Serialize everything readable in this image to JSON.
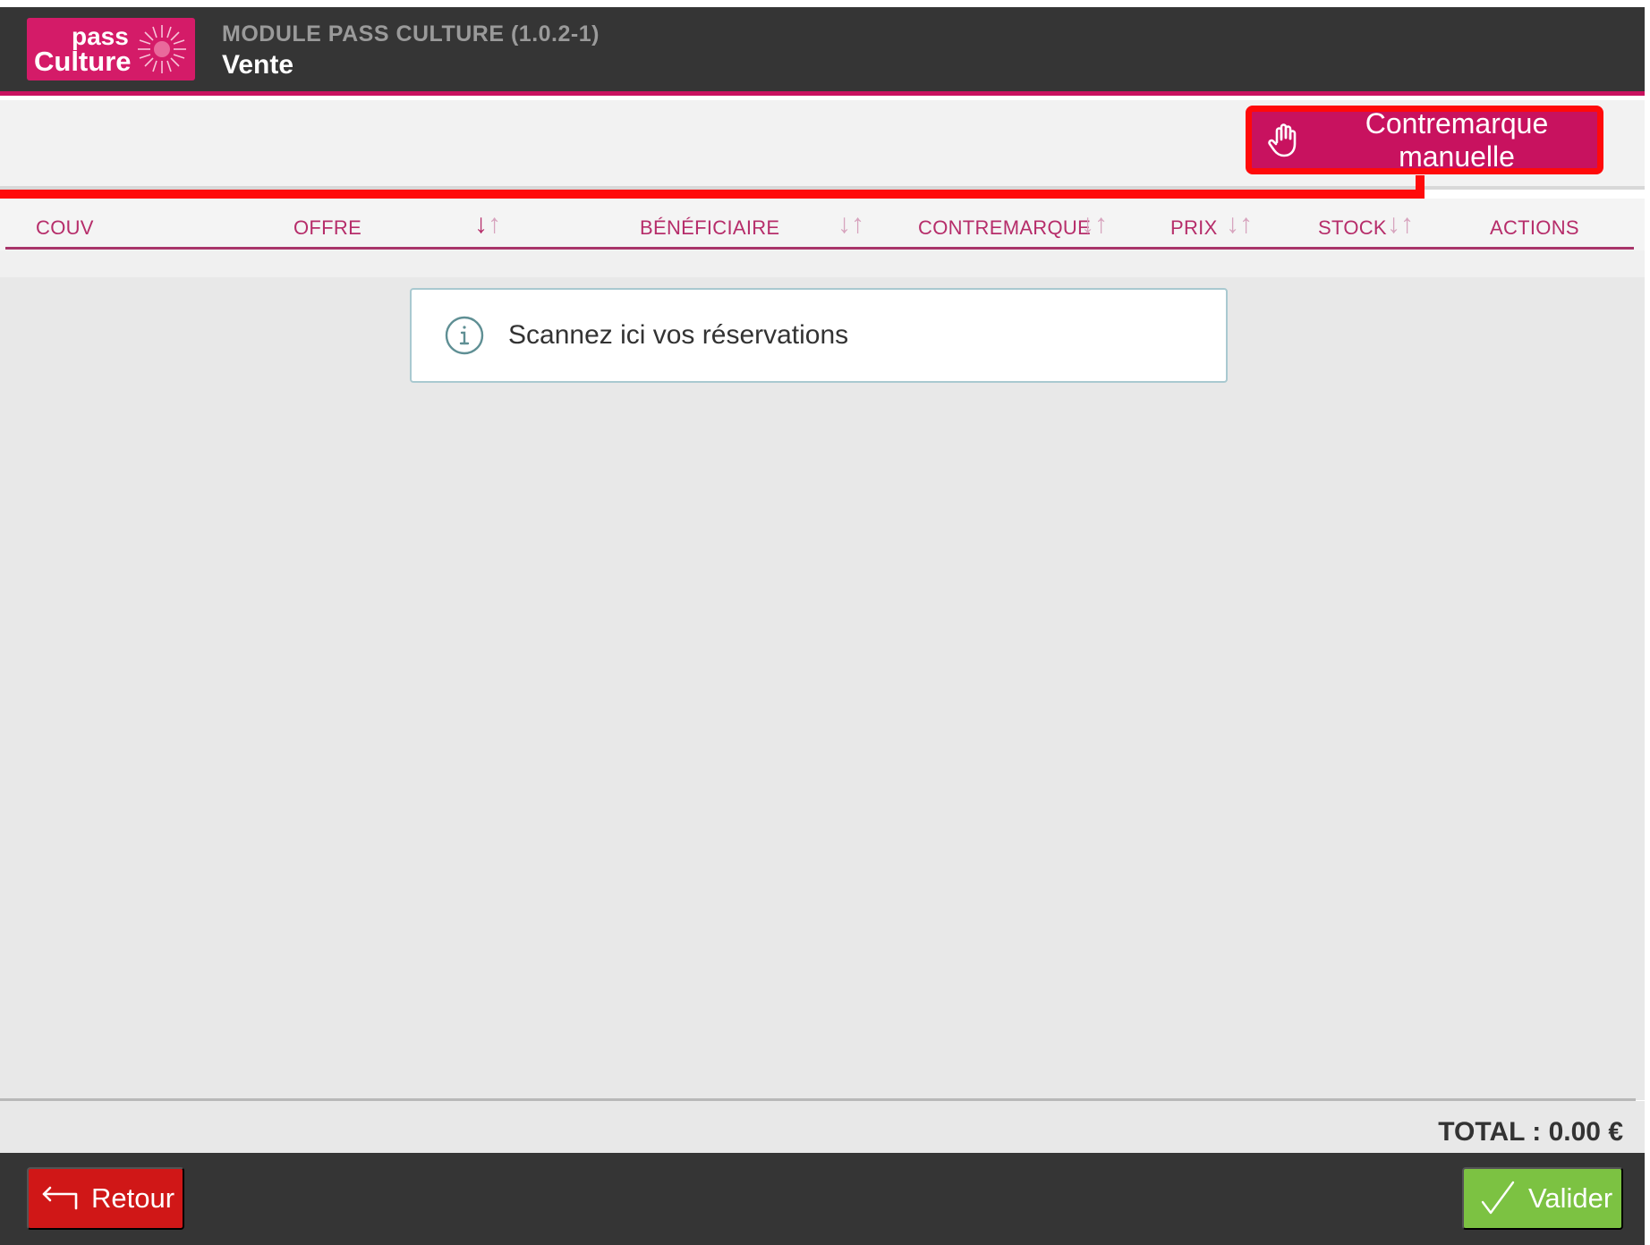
{
  "header": {
    "logo_line1": "pass",
    "logo_line2": "Culture",
    "module_title": "MODULE PASS CULTURE (1.0.2-1)",
    "page_title": "Vente"
  },
  "toolbar": {
    "manual_label": "Contremarque manuelle"
  },
  "table": {
    "columns": [
      {
        "label": "COUV"
      },
      {
        "label": "OFFRE"
      },
      {
        "label": "BÉNÉFICIAIRE"
      },
      {
        "label": "CONTREMARQUE"
      },
      {
        "label": "PRIX"
      },
      {
        "label": "STOCK"
      },
      {
        "label": "ACTIONS"
      }
    ],
    "sort_down": "↓",
    "sort_up": "↑"
  },
  "scan": {
    "message": "Scannez ici vos réservations"
  },
  "total": {
    "label": "TOTAL : 0.00 €"
  },
  "footer": {
    "back_label": "Retour",
    "validate_label": "Valider"
  },
  "colors": {
    "brand": "#c8125f",
    "highlight": "#ff0a0a",
    "header_bg": "#353535",
    "validate": "#7cc242",
    "back": "#d01717"
  },
  "icons": {
    "manual": "hand-icon",
    "info": "info-icon",
    "back": "return-arrow-icon",
    "validate": "check-icon"
  }
}
